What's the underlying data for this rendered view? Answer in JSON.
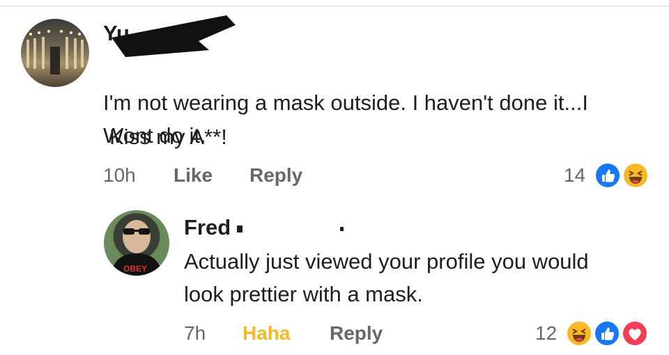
{
  "comment1": {
    "name": "Yu",
    "text": "I'm not wearing a mask outside. I haven't done it...I Wont do it.",
    "text_line2": "Kiss my A**!",
    "time": "10h",
    "like_label": "Like",
    "reply_label": "Reply",
    "reaction_count": "14",
    "reactions": [
      "like-icon",
      "haha-icon"
    ]
  },
  "comment2": {
    "name": "Fred",
    "text": "Actually just viewed your profile you would look prettier with a mask.",
    "time": "7h",
    "reaction_label": "Haha",
    "reply_label": "Reply",
    "reaction_count": "12",
    "reactions": [
      "haha-icon",
      "like-icon",
      "love-icon"
    ]
  },
  "colors": {
    "like": "#1877f2",
    "haha": "#f7b928",
    "love": "#f33e58",
    "meta": "#65676b"
  }
}
